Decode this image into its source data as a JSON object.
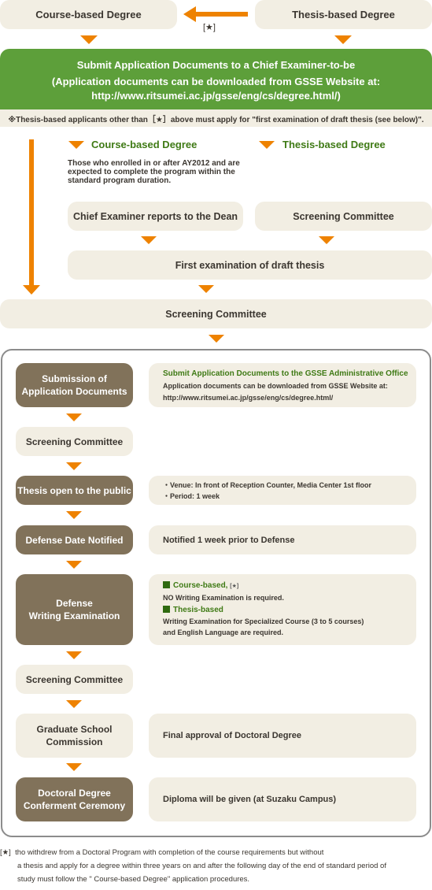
{
  "top": {
    "course_based": "Course-based Degree",
    "thesis_based": "Thesis-based Degree",
    "arrow_note": "[★]"
  },
  "submit": {
    "line1": "Submit Application Documents to a Chief Examiner-to-be",
    "line2": "(Application documents can be downloaded from GSSE Website at:",
    "line3": "http://www.ritsumei.ac.jp/gsse/eng/cs/degree.html/)"
  },
  "note": "※Thesis-based applicants other than［★］above must apply for \"first examination of draft thesis (see below)\".",
  "branches": {
    "course_heading": "Course-based Degree",
    "thesis_heading": "Thesis-based Degree",
    "course_desc": "Those who enrolled in or after AY2012 and are expected to complete the program within the standard program duration.",
    "chief_examiner": "Chief Examiner reports to the Dean",
    "screening_committee": "Screening Committee",
    "first_exam": "First examination of draft thesis",
    "screening_committee_full": "Screening Committee"
  },
  "steps": [
    {
      "label_l1": "Submission of",
      "label_l2": "Application Documents",
      "style": "dark"
    },
    {
      "label_l1": "Screening Committee",
      "label_l2": "",
      "style": "light"
    },
    {
      "label_l1": "Thesis open to the public",
      "label_l2": "",
      "style": "dark"
    },
    {
      "label_l1": "Defense Date Notified",
      "label_l2": "",
      "style": "dark"
    },
    {
      "label_l1": "Defense",
      "label_l2": "Writing Examination",
      "style": "dark"
    },
    {
      "label_l1": "Screening Committee",
      "label_l2": "",
      "style": "light"
    },
    {
      "label_l1": "Graduate School",
      "label_l2": "Commission",
      "style": "light"
    },
    {
      "label_l1": "Doctoral Degree",
      "label_l2": "Conferment Ceremony",
      "style": "dark"
    }
  ],
  "details": {
    "submission_title": "Submit Application Documents to the GSSE Administrative Office",
    "submission_l1": "Application documents can be downloaded from GSSE Website at:",
    "submission_l2": "http://www.ritsumei.ac.jp/gsse/eng/cs/degree.html/",
    "public_venue": "・Venue: In front of Reception Counter, Media Center 1st floor",
    "public_period": "・Period: 1 week",
    "defense_notice": "Notified 1 week prior to Defense",
    "course_based_title": "Course-based,",
    "course_based_star": "[★]",
    "course_based_text": "NO Writing Examination is required.",
    "thesis_based_title": "Thesis-based",
    "thesis_based_l1": "Writing Examination for Specialized Course (3 to 5 courses)",
    "thesis_based_l2": "and English Language are required.",
    "final_approval": "Final approval of Doctoral Degree",
    "diploma": "Diploma will be given (at Suzaku Campus)"
  },
  "footnote": {
    "star": "[★]",
    "l1": "tho withdrew from a Doctoral Program with completion of the course requirements but without",
    "l2": "a thesis and apply for a degree within three years on and after the following day of the end of standard period of",
    "l3": "study must follow the \" Course-based Degree\" application procedures."
  },
  "colors": {
    "accent_orange": "#ee8200",
    "green": "#5d9f3a",
    "dark_box": "#81725a",
    "light_box": "#f2eee3"
  }
}
